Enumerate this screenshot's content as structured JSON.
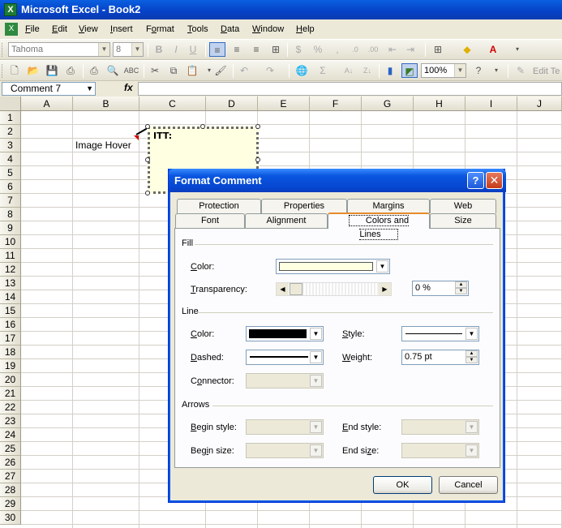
{
  "window": {
    "title": "Microsoft Excel - Book2"
  },
  "menu": [
    {
      "label": "File",
      "u": "F",
      "rest": "ile"
    },
    {
      "label": "Edit",
      "u": "E",
      "rest": "dit"
    },
    {
      "label": "View",
      "u": "V",
      "rest": "iew"
    },
    {
      "label": "Insert",
      "u": "I",
      "rest": "nsert"
    },
    {
      "label": "Format",
      "u": "o",
      "pre": "F",
      "rest": "rmat"
    },
    {
      "label": "Tools",
      "u": "T",
      "rest": "ools"
    },
    {
      "label": "Data",
      "u": "D",
      "rest": "ata"
    },
    {
      "label": "Window",
      "u": "W",
      "rest": "indow"
    },
    {
      "label": "Help",
      "u": "H",
      "rest": "elp"
    }
  ],
  "toolbar": {
    "font_name": "Tahoma",
    "font_size": "8",
    "zoom": "100%",
    "edit_label": "Edit Te"
  },
  "formula": {
    "name_box": "Comment 7",
    "fx": "fx"
  },
  "grid": {
    "columns": [
      "A",
      "B",
      "C",
      "D",
      "E",
      "F",
      "G",
      "H",
      "I",
      "J"
    ],
    "rows": [
      "1",
      "2",
      "3",
      "4",
      "5",
      "6",
      "7",
      "8",
      "9",
      "10",
      "11",
      "12",
      "13",
      "14",
      "15",
      "16",
      "17",
      "18",
      "19",
      "20",
      "21",
      "22",
      "23",
      "24",
      "25",
      "26",
      "27",
      "28",
      "29",
      "30"
    ],
    "cell_b3": "Image Hover",
    "comment_text": "ITT:"
  },
  "dialog": {
    "title": "Format Comment",
    "help": "?",
    "close": "✕",
    "tabs_back": [
      "Protection",
      "Properties",
      "Margins",
      "Web"
    ],
    "tabs_front": [
      "Font",
      "Alignment",
      "Colors and Lines",
      "Size"
    ],
    "fill_group": "Fill",
    "fill_color_label": "Color:",
    "fill_color": "#ffffe1",
    "transparency_label": "Transparency:",
    "transparency_value": "0 %",
    "line_group": "Line",
    "line_color_label": "Color:",
    "line_color": "#000000",
    "style_label": "Style:",
    "dashed_label": "Dashed:",
    "weight_label": "Weight:",
    "weight_value": "0.75 pt",
    "connector_label": "Connector:",
    "arrows_group": "Arrows",
    "begin_style_label": "Begin style:",
    "end_style_label": "End style:",
    "begin_size_label": "Begin size:",
    "end_size_label": "End size:",
    "ok": "OK",
    "cancel": "Cancel"
  }
}
